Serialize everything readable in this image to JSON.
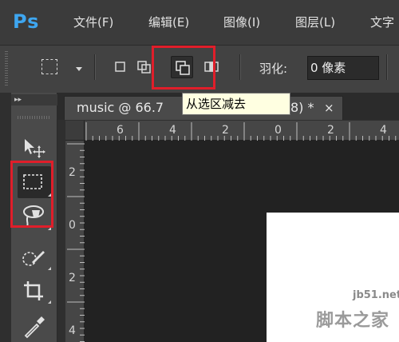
{
  "app": {
    "logo": "Ps",
    "brand_color": "#3ea6f0"
  },
  "menubar": {
    "items": [
      {
        "label": "文件(F)"
      },
      {
        "label": "编辑(E)"
      },
      {
        "label": "图像(I)"
      },
      {
        "label": "图层(L)"
      },
      {
        "label": "文字"
      }
    ]
  },
  "options_bar": {
    "marquee_preset_icon": "rect-marquee-icon",
    "selection_modes": [
      {
        "name": "new-selection",
        "icon": "new-selection-icon"
      },
      {
        "name": "add-to-selection",
        "icon": "add-selection-icon"
      },
      {
        "name": "subtract-from-selection",
        "icon": "subtract-selection-icon",
        "active": true
      },
      {
        "name": "intersect-with-selection",
        "icon": "intersect-selection-icon"
      }
    ],
    "feather_label": "羽化:",
    "feather_value": "0 像素"
  },
  "tooltip": {
    "text": "从选区减去"
  },
  "document": {
    "tab_title_left": "music @ 66.7",
    "tab_title_right": "8) *",
    "close_glyph": "×"
  },
  "rulers": {
    "horizontal": [
      "6",
      "4",
      "2",
      "0",
      "2",
      "4"
    ],
    "vertical": [
      "2",
      "0",
      "2",
      "4"
    ]
  },
  "toolbar": {
    "collapse_glyph": "▸▸",
    "tools": [
      {
        "name": "move-tool",
        "icon": "move-icon"
      },
      {
        "name": "rect-marquee-tool",
        "icon": "rect-marquee-icon",
        "active": true
      },
      {
        "name": "lasso-tool",
        "icon": "lasso-icon"
      },
      {
        "name": "quick-selection-tool",
        "icon": "quick-selection-icon"
      },
      {
        "name": "crop-tool",
        "icon": "crop-icon"
      },
      {
        "name": "eyedropper-tool",
        "icon": "eyedropper-icon"
      }
    ]
  },
  "annotation": {
    "highlight_color": "#e01e2a"
  },
  "watermark": {
    "url": "jb51.net",
    "name": "脚本之家"
  }
}
